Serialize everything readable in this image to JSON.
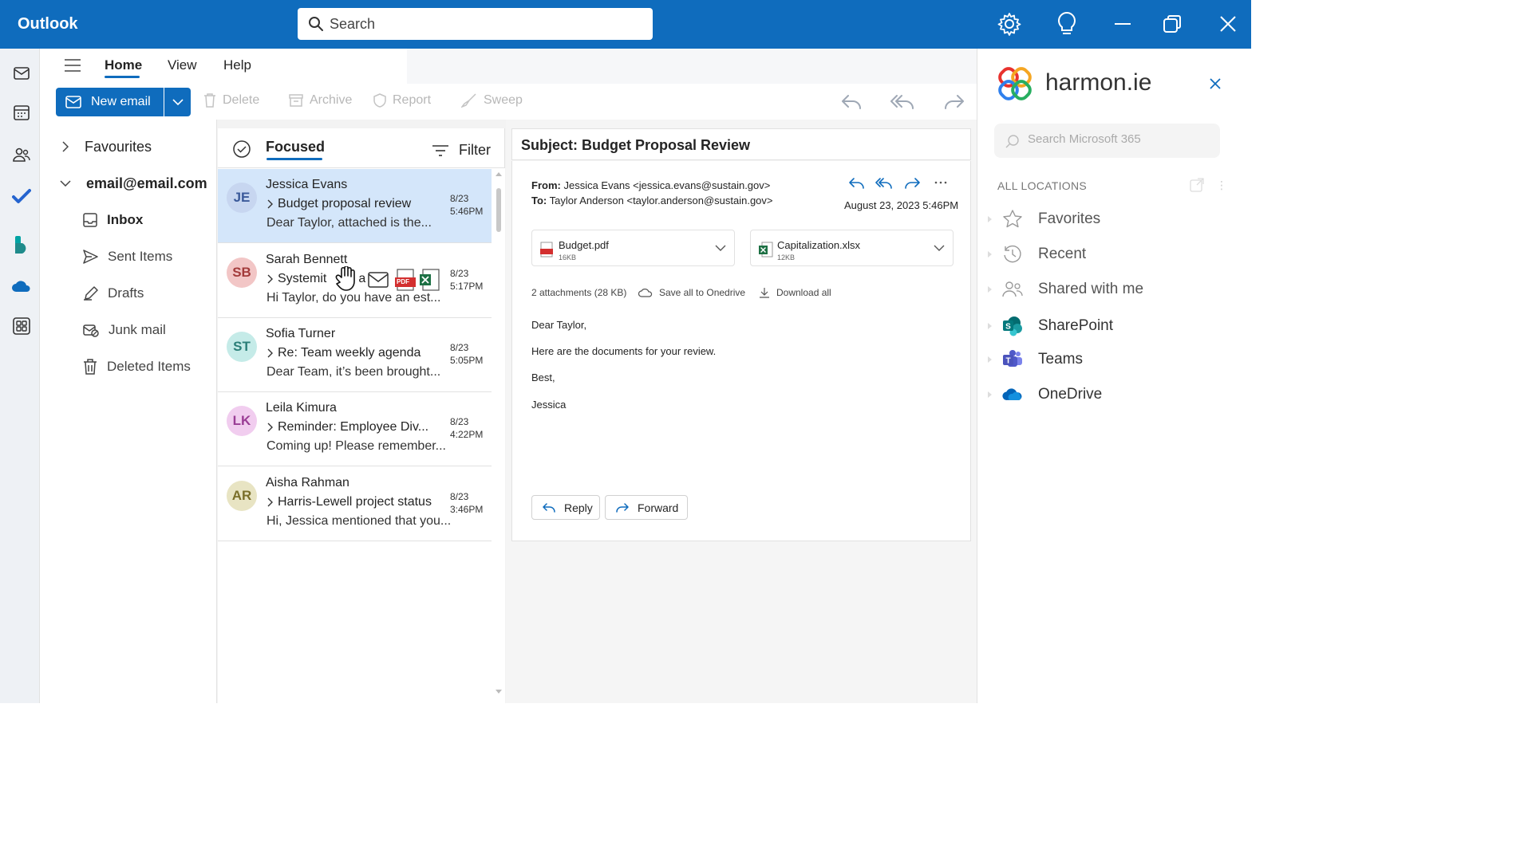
{
  "app": {
    "title": "Outlook"
  },
  "search": {
    "placeholder": "Search"
  },
  "window_controls": [
    "gear-icon",
    "lightbulb-icon",
    "minimize-icon",
    "restore-icon",
    "close-icon"
  ],
  "rail": [
    "mail-icon",
    "calendar-icon",
    "people-icon",
    "todo-icon",
    "bookings-icon",
    "onedrive-icon",
    "apps-icon"
  ],
  "ribbon": {
    "tabs": [
      {
        "label": "Home",
        "active": true
      },
      {
        "label": "View"
      },
      {
        "label": "Help"
      }
    ],
    "new_email": "New email",
    "actions": [
      "Delete",
      "Archive",
      "Report",
      "Sweep"
    ]
  },
  "folders": {
    "favourites": "Favourites",
    "account": "email@email.com",
    "items": [
      {
        "label": "Inbox",
        "icon": "inbox-icon",
        "bold": true
      },
      {
        "label": "Sent Items",
        "icon": "send-icon"
      },
      {
        "label": "Drafts",
        "icon": "drafts-icon"
      },
      {
        "label": "Junk mail",
        "icon": "junk-icon"
      },
      {
        "label": "Deleted Items",
        "icon": "trash-icon"
      }
    ]
  },
  "list": {
    "focused": "Focused",
    "filter": "Filter",
    "messages": [
      {
        "initials": "JE",
        "sender": "Jessica Evans",
        "subject": "Budget proposal review",
        "preview": "Dear Taylor, attached is the...",
        "date": "8/23",
        "time": "5:46PM",
        "avatar_bg": "#c7d6f0",
        "avatar_fg": "#3b5a9a"
      },
      {
        "initials": "SB",
        "sender": "Sarah Bennett",
        "subject": "Systemit",
        "subject_tail": "a",
        "preview": "Hi Taylor, do you have an est...",
        "date": "8/23",
        "time": "5:17PM",
        "avatar_bg": "#f2c6c6",
        "avatar_fg": "#a33b3b"
      },
      {
        "initials": "ST",
        "sender": "Sofia Turner",
        "subject": "Re: Team weekly agenda",
        "preview": "Dear Team, it’s been brought...",
        "date": "8/23",
        "time": "5:05PM",
        "avatar_bg": "#c5ebe8",
        "avatar_fg": "#2b7f78"
      },
      {
        "initials": "LK",
        "sender": "Leila Kimura",
        "subject": "Reminder: Employee Div...",
        "preview": "Coming up! Please remember...",
        "date": "8/23",
        "time": "4:22PM",
        "avatar_bg": "#f1cdef",
        "avatar_fg": "#9a3d95"
      },
      {
        "initials": "AR",
        "sender": "Aisha Rahman",
        "subject": "Harris-Lewell project status",
        "preview": "Hi, Jessica mentioned that you...",
        "date": "8/23",
        "time": "3:46PM",
        "avatar_bg": "#e8e4c3",
        "avatar_fg": "#7a6f2a"
      }
    ]
  },
  "reading": {
    "subject": "Subject: Budget Proposal Review",
    "from_label": "From:",
    "from": "Jessica Evans <jessica.evans@sustain.gov>",
    "to_label": "To:",
    "to": "Taylor Anderson <taylor.anderson@sustain.gov>",
    "date": "August 23, 2023 5:46PM",
    "attachments": [
      {
        "name": "Budget.pdf",
        "size": "16KB",
        "icon": "pdf-icon"
      },
      {
        "name": "Capitalization.xlsx",
        "size": "12KB",
        "icon": "excel-icon"
      }
    ],
    "attachments_summary": "2 attachments (28 KB)",
    "save_all": "Save all to Onedrive",
    "download_all": "Download all",
    "body": [
      "Dear Taylor,",
      "Here are the documents for your review.",
      "Best,",
      "Jessica"
    ],
    "reply": "Reply",
    "forward": "Forward"
  },
  "drag_overlay": {
    "pdf_badge": "PDF"
  },
  "harmonie": {
    "brand": "harmon.ie",
    "search_placeholder": "Search Microsoft 365",
    "all_locations": "ALL LOCATIONS",
    "items": [
      {
        "label": "Favorites",
        "icon": "star-icon"
      },
      {
        "label": "Recent",
        "icon": "clock-icon"
      },
      {
        "label": "Shared with me",
        "icon": "people-icon"
      },
      {
        "label": "SharePoint",
        "icon": "sharepoint-icon"
      },
      {
        "label": "Teams",
        "icon": "teams-icon"
      },
      {
        "label": "OneDrive",
        "icon": "onedrive-icon"
      }
    ]
  }
}
